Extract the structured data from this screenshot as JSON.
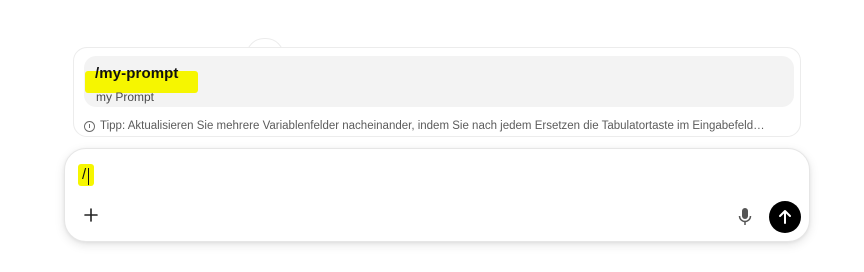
{
  "suggestions": {
    "items": [
      {
        "title": "/my-prompt",
        "subtitle": "my Prompt"
      }
    ],
    "tip": "Tipp: Aktualisieren Sie mehrere Variablenfelder nacheinander, indem Sie nach jedem Ersetzen die Tabulatortaste im Eingabefeld…",
    "tip_icon": "info-icon",
    "highlight_color": "#f6f600"
  },
  "composer": {
    "input_value": "/",
    "add_icon": "plus-icon",
    "mic_icon": "microphone-icon",
    "send_icon": "arrow-up-icon",
    "send_button_color": "#000000"
  }
}
